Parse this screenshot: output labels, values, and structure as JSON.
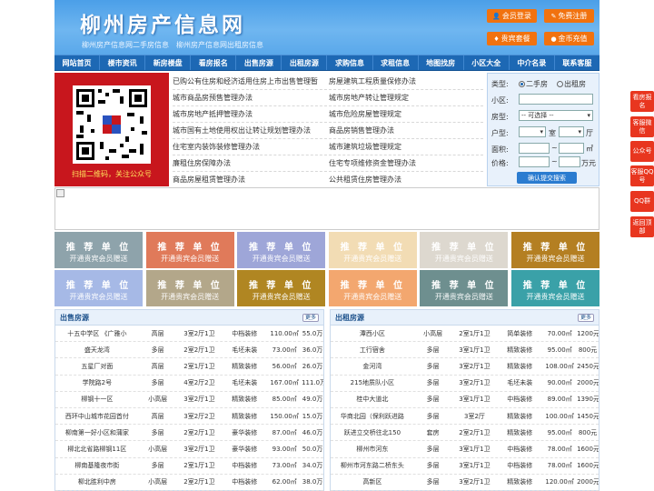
{
  "header": {
    "title": "柳州房产信息网",
    "subtitle": "柳州房产信息网二手房信息　柳州房产信息网出租房信息",
    "buttons": [
      "会员登录",
      "免费注册",
      "贵宾套餐",
      "金币充值"
    ]
  },
  "nav": [
    "网站首页",
    "楼市资讯",
    "新房楼盘",
    "看房报名",
    "出售房源",
    "出租房源",
    "求购信息",
    "求租信息",
    "地图找房",
    "小区大全",
    "中介名录",
    "联系客服"
  ],
  "qr": {
    "caption": "扫描二维码，关注公众号"
  },
  "links_left": [
    "已购公有住房和经济适用住房上市出售管理暂",
    "城市商品房预售管理办法",
    "城市房地产抵押管理办法",
    "城市国有土地使用权出让转让规划管理办法",
    "住宅室内装饰装修管理办法",
    "廉租住房保障办法",
    "商品房屋租赁管理办法"
  ],
  "links_right": [
    "房屋建筑工程质量保修办法",
    "城市房地产转让管理规定",
    "城市危险房屋管理规定",
    "商品房销售管理办法",
    "城市建筑垃圾管理规定",
    "住宅专项维修资金管理办法",
    "公共租赁住房管理办法"
  ],
  "search": {
    "type_label": "类型:",
    "type_options": [
      "二手房",
      "出租房"
    ],
    "community_label": "小区:",
    "house_label": "房型:",
    "house_placeholder": "-- 可选择 --",
    "layout_label": "户型:",
    "room": "室",
    "hall": "厅",
    "area_label": "面积:",
    "area_unit": "㎡",
    "price_label": "价格:",
    "price_unit": "万元",
    "submit": "确认提交搜索"
  },
  "rec": {
    "title": "推 荐 单 位",
    "sub": "开通贵宾会员赠送",
    "colors": [
      "#8ea3ab",
      "#e07a5a",
      "#9ea6d8",
      "#f2dcb4",
      "#ddd8cf",
      "#b47f22",
      "#a6b9e6",
      "#b3a78a",
      "#b08622",
      "#f3a76f",
      "#6e8f8f",
      "#3aa1a8"
    ]
  },
  "sale": {
    "title": "出售房源",
    "more": "更多",
    "rows": [
      [
        "十五中学区 《广雅小",
        "高层",
        "3室2厅1卫",
        "中档装修",
        "110.00㎡",
        "55.0万"
      ],
      [
        "盛天龙湾",
        "多层",
        "2室2厅1卫",
        "毛坯未装",
        "73.00㎡",
        "36.0万"
      ],
      [
        "五星厂对面",
        "高层",
        "2室1厅1卫",
        "精致装修",
        "56.00㎡",
        "26.0万"
      ],
      [
        "学院路2号",
        "多层",
        "4室2厅2卫",
        "毛坯未装",
        "167.00㎡",
        "111.0万"
      ],
      [
        "柳钢十一区",
        "小高层",
        "3室2厅1卫",
        "精致装修",
        "85.00㎡",
        "49.0万"
      ],
      [
        "西环中山城市花园首付",
        "高层",
        "3室2厅2卫",
        "精致装修",
        "150.00㎡",
        "15.0万"
      ],
      [
        "柳南第一好小区和蒲家",
        "多层",
        "2室2厅1卫",
        "豪华装修",
        "87.00㎡",
        "46.0万"
      ],
      [
        "柳北北省路柳钢11区",
        "小高层",
        "3室2厅1卫",
        "豪华装修",
        "93.00㎡",
        "50.0万"
      ],
      [
        "柳南基隆夜市街",
        "多层",
        "2室1厅1卫",
        "中档装修",
        "73.00㎡",
        "34.0万"
      ],
      [
        "柳北胜利中房",
        "小高层",
        "2室2厅1卫",
        "中档装修",
        "62.00㎡",
        "38.0万"
      ]
    ]
  },
  "rent": {
    "title": "出租房源",
    "more": "更多",
    "rows": [
      [
        "潭西小区",
        "小高层",
        "2室1厅1卫",
        "简单装修",
        "70.00㎡",
        "1200元"
      ],
      [
        "工行宿舍",
        "多层",
        "3室1厅1卫",
        "精致装修",
        "95.00㎡",
        "800元"
      ],
      [
        "金河湾",
        "多层",
        "3室2厅1卫",
        "精致装修",
        "108.00㎡",
        "2450元"
      ],
      [
        "215地质队小区",
        "多层",
        "3室2厅1卫",
        "毛坯未装",
        "90.00㎡",
        "2000元"
      ],
      [
        "桂中大道北",
        "多层",
        "3室1厅1卫",
        "中档装修",
        "89.00㎡",
        "1390元"
      ],
      [
        "华商北园（保利跃进路",
        "多层",
        "3室2厅",
        "精致装修",
        "100.00㎡",
        "1450元"
      ],
      [
        "跃进立交桥往北150",
        "套房",
        "2室2厅1卫",
        "精致装修",
        "95.00㎡",
        "800元"
      ],
      [
        "柳州市河东",
        "多层",
        "3室1厅1卫",
        "中档装修",
        "78.00㎡",
        "1600元"
      ],
      [
        "柳州市河东路二桥东头",
        "多层",
        "3室1厅1卫",
        "中档装修",
        "78.00㎡",
        "1600元"
      ],
      [
        "高新区",
        "多层",
        "3室2厅1卫",
        "精致装修",
        "120.00㎡",
        "2000元"
      ]
    ]
  },
  "side": [
    "看房报名",
    "客服微信",
    "公众号",
    "客服QQ号",
    "QQ群",
    "返回顶部"
  ]
}
